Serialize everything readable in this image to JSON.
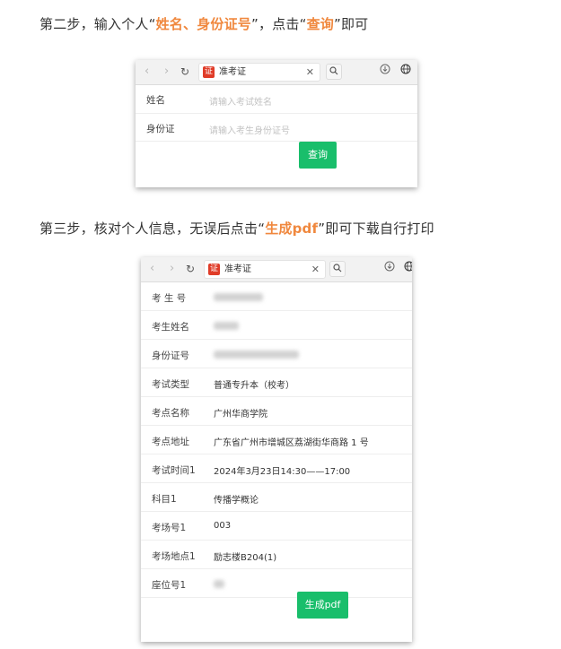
{
  "step2": {
    "prefix": "第二步，输入个人",
    "q_open": "“",
    "highlight": "姓名、身份证号",
    "q_close": "”",
    "middle": "，点击",
    "q_open2": "“",
    "button_ref": "查询",
    "q_close2": "”",
    "suffix": "即可"
  },
  "step3": {
    "prefix": "第三步，核对个人信息，无误后点击",
    "q_open": "“",
    "highlight": "生成pdf",
    "q_close": "”",
    "suffix": "即可下载自行打印"
  },
  "browser": {
    "back_icon": "‹",
    "forward_icon": "›",
    "reload_icon": "↻",
    "tab_title": "准考证",
    "close_icon": "✕",
    "search_icon": "🔍",
    "download_icon": "↓",
    "globe_icon": "🌐"
  },
  "form": {
    "name_label": "姓名",
    "name_placeholder": "请输入考试姓名",
    "id_label": "身份证",
    "id_placeholder": "请输入考生身份证号",
    "query_button": "查询"
  },
  "info": {
    "rows": [
      {
        "label": "考 生 号",
        "value": ""
      },
      {
        "label": "考生姓名",
        "value": ""
      },
      {
        "label": "身份证号",
        "value": ""
      },
      {
        "label": "考试类型",
        "value": "普通专升本（校考）"
      },
      {
        "label": "考点名称",
        "value": "广州华商学院"
      },
      {
        "label": "考点地址",
        "value": "广东省广州市增城区荔湖街华商路 1 号"
      },
      {
        "label": "考试时间1",
        "value": "2024年3月23日14:30——17:00"
      },
      {
        "label": "科目1",
        "value": "传播学概论"
      },
      {
        "label": "考场号1",
        "value": "003"
      },
      {
        "label": "考场地点1",
        "value": "励志楼B204(1)"
      },
      {
        "label": "座位号1",
        "value": ""
      }
    ],
    "pdf_button": "生成pdf"
  },
  "colors": {
    "highlight": "#f0883e",
    "button_green": "#19be6b"
  }
}
